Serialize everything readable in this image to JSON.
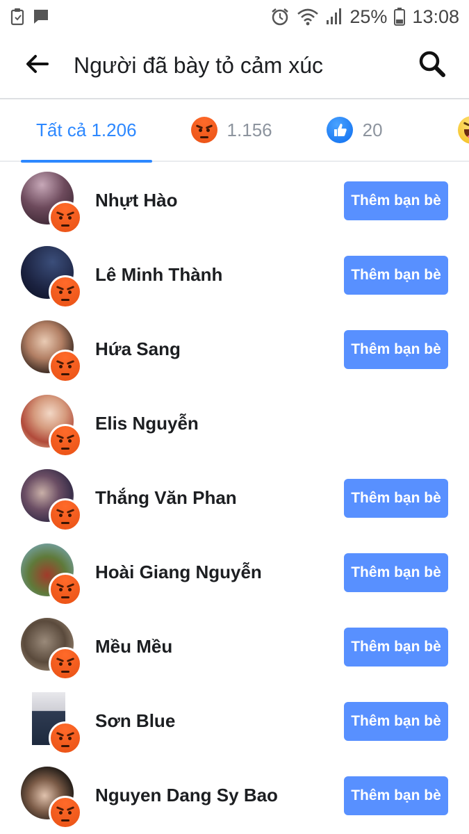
{
  "status_bar": {
    "battery": "25%",
    "time": "13:08"
  },
  "header": {
    "title": "Người đã bày tỏ cảm xúc"
  },
  "tabs": [
    {
      "label": "Tất cả 1.206",
      "reaction": "all",
      "active": true
    },
    {
      "label": "1.156",
      "reaction": "angry-icon"
    },
    {
      "label": "20",
      "reaction": "like-icon"
    },
    {
      "label": "",
      "reaction": "haha-icon"
    }
  ],
  "people": [
    {
      "name": "Nhựt Hào",
      "reaction": "angry-icon",
      "button": "Thêm bạn bè"
    },
    {
      "name": "Lê Minh Thành",
      "reaction": "angry-icon",
      "button": "Thêm bạn bè"
    },
    {
      "name": "Hứa Sang",
      "reaction": "angry-icon",
      "button": "Thêm bạn bè"
    },
    {
      "name": "Elis Nguyễn",
      "reaction": "angry-icon",
      "button": null
    },
    {
      "name": "Thắng Văn Phan",
      "reaction": "angry-icon",
      "button": "Thêm bạn bè"
    },
    {
      "name": "Hoài Giang Nguyễn",
      "reaction": "angry-icon",
      "button": "Thêm bạn bè"
    },
    {
      "name": "Mều Mều",
      "reaction": "angry-icon",
      "button": "Thêm bạn bè"
    },
    {
      "name": "Sơn Blue",
      "reaction": "angry-icon",
      "button": "Thêm bạn bè"
    },
    {
      "name": "Nguyen Dang Sy Bao",
      "reaction": "angry-icon",
      "button": "Thêm bạn bè"
    }
  ],
  "colors": {
    "accent": "#2d88ff",
    "button": "#5890ff",
    "angry": "#f25c1e"
  }
}
